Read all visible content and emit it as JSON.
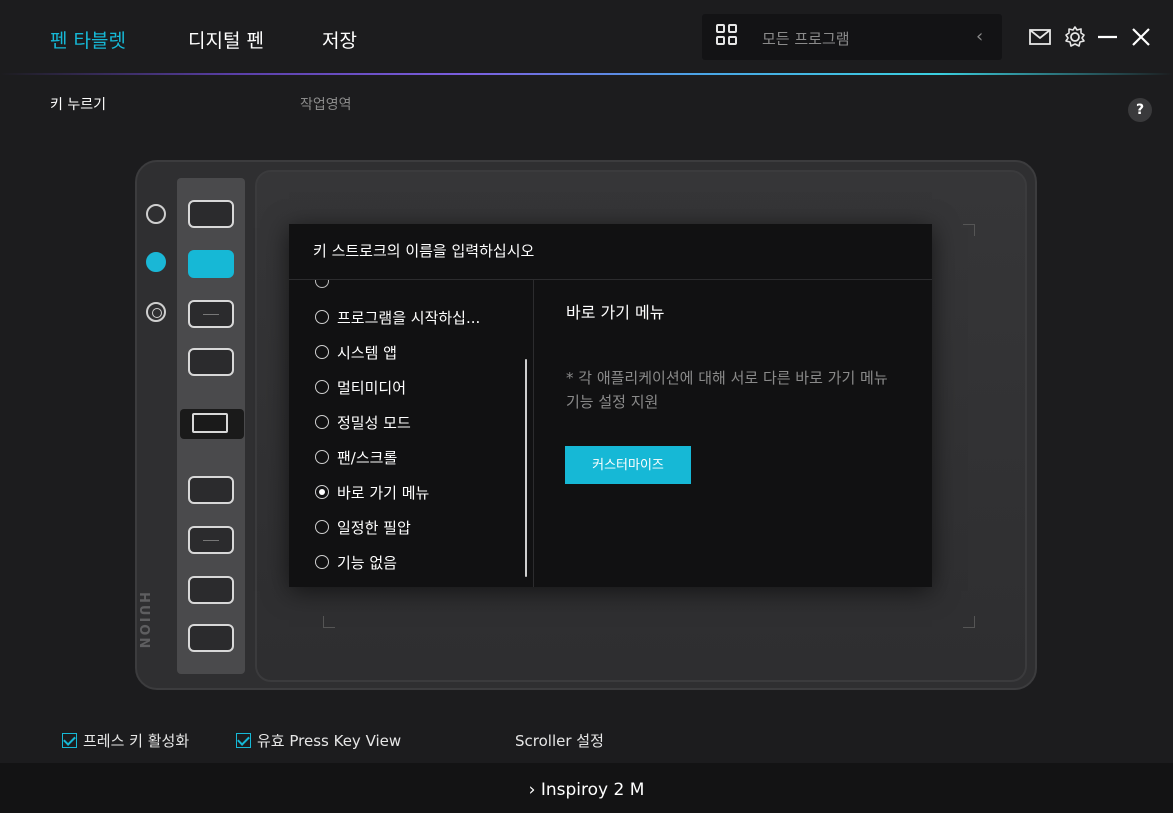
{
  "header": {
    "tabs": [
      {
        "label": "펜 타블렛",
        "active": true
      },
      {
        "label": "디지털 펜",
        "active": false
      },
      {
        "label": "저장",
        "active": false
      }
    ],
    "program_selector": {
      "label": "모든 프로그램",
      "icon": "grid-icon"
    },
    "icons": [
      "mail-icon",
      "gear-icon",
      "minimize-icon",
      "close-icon"
    ]
  },
  "subtabs": [
    {
      "label": "키 누르기",
      "active": true
    },
    {
      "label": "작업영역",
      "active": false
    }
  ],
  "help": {
    "label": "?"
  },
  "tablet": {
    "brand": "HUION",
    "active_side_button": 2,
    "active_key": 2
  },
  "dialog": {
    "title": "키 스트로크의 이름을 입력하십시오",
    "options": [
      {
        "label": "프로그램을 시작하십...",
        "checked": false
      },
      {
        "label": "시스템 앱",
        "checked": false
      },
      {
        "label": "멀티미디어",
        "checked": false
      },
      {
        "label": "정밀성 모드",
        "checked": false
      },
      {
        "label": "팬/스크롤",
        "checked": false
      },
      {
        "label": "바로 가기 메뉴",
        "checked": true
      },
      {
        "label": "일정한 필압",
        "checked": false
      },
      {
        "label": "기능 없음",
        "checked": false
      }
    ],
    "detail_title": "바로 가기 메뉴",
    "detail_note": "* 각 애플리케이션에 대해 서로 다른 바로 가기 메뉴 기능 설정 지원",
    "customize_label": "커스터마이즈"
  },
  "bottom": {
    "enable_press_keys": {
      "label": "프레스 키 활성화",
      "checked": true
    },
    "press_key_view": {
      "label": "유효 Press Key View",
      "checked": true
    },
    "scroller_settings": "Scroller 설정"
  },
  "footer": {
    "device_name": "Inspiroy 2 M"
  },
  "colors": {
    "accent": "#16b8d6",
    "background": "#1c1c1e",
    "dialog_bg": "#111112"
  }
}
